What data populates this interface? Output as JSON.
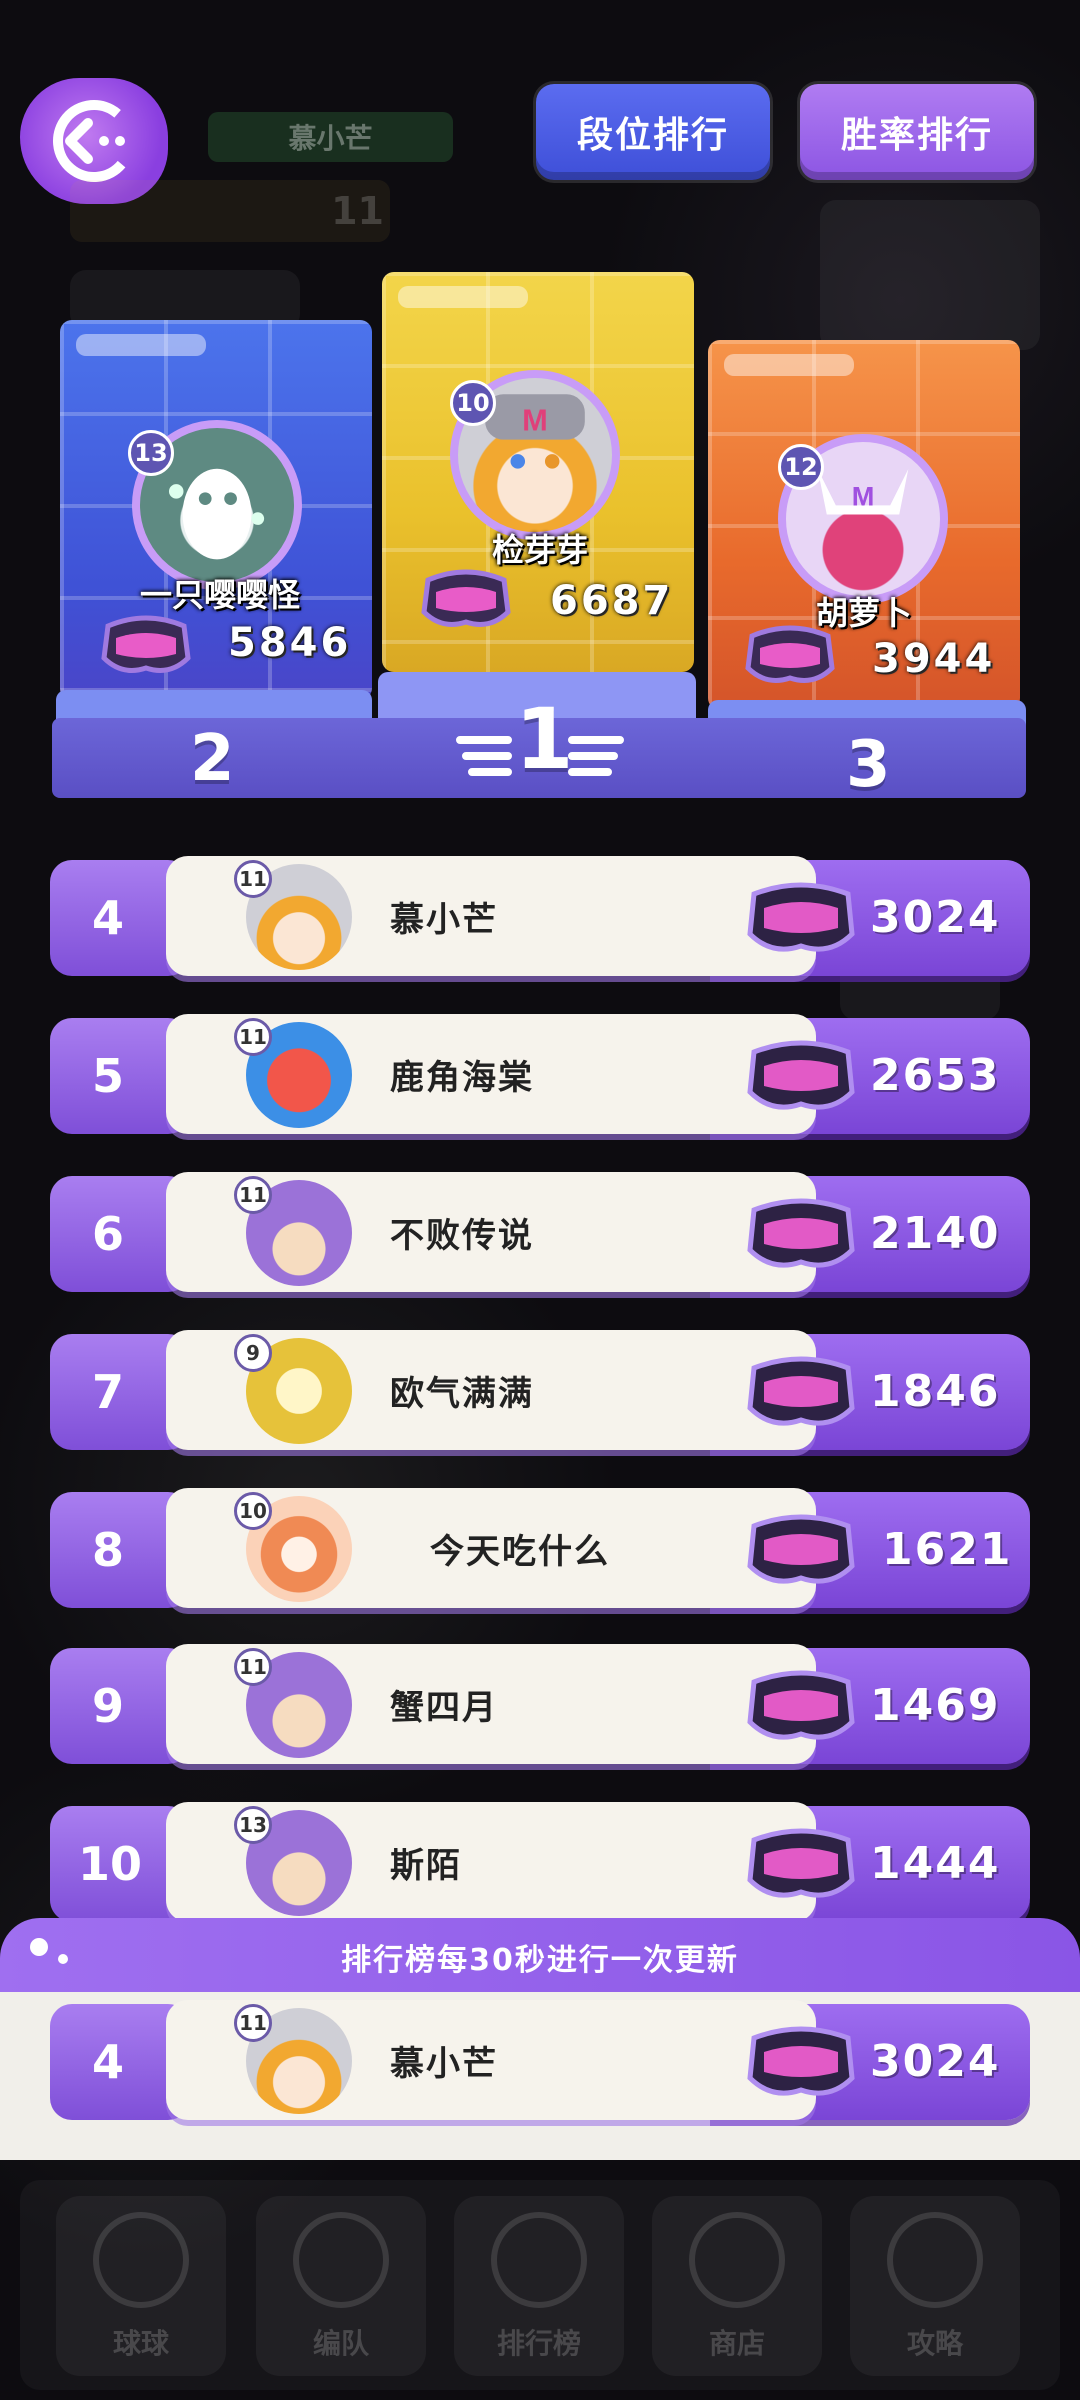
{
  "header": {
    "player_name": "慕小芒",
    "player_level": "11",
    "tabs": [
      {
        "label": "段位排行",
        "active": true
      },
      {
        "label": "胜率排行",
        "active": false
      }
    ]
  },
  "podium": [
    {
      "rank": "2",
      "name": "一只嘤嘤怪",
      "level": "13",
      "score": "5846",
      "color": "#4c74ec"
    },
    {
      "rank": "1",
      "name": "检芽芽",
      "level": "10",
      "score": "6687",
      "color": "#f3d54a"
    },
    {
      "rank": "3",
      "name": "胡萝卜",
      "level": "12",
      "score": "3944",
      "color": "#f6944a"
    }
  ],
  "leaderboard": [
    {
      "rank": "4",
      "name": "慕小芒",
      "level": "11",
      "score": "3024",
      "avatar": "gray-hat-orange-hood-avatar"
    },
    {
      "rank": "5",
      "name": "鹿角海棠",
      "level": "11",
      "score": "2653",
      "avatar": "red-hair-blue-avatar"
    },
    {
      "rank": "6",
      "name": "不败传说",
      "level": "11",
      "score": "2140",
      "avatar": "purple-hat-girl-avatar"
    },
    {
      "rank": "7",
      "name": "欧气满满",
      "level": "9",
      "score": "1846",
      "avatar": "gold-emblem-avatar"
    },
    {
      "rank": "8",
      "name": "今天吃什么",
      "level": "10",
      "score": "1621",
      "avatar": "orange-flame-avatar"
    },
    {
      "rank": "9",
      "name": "蟹四月",
      "level": "11",
      "score": "1469",
      "avatar": "purple-hat-girl-avatar"
    },
    {
      "rank": "10",
      "name": "斯陌",
      "level": "13",
      "score": "1444",
      "avatar": "purple-hat-girl-avatar"
    }
  ],
  "update_notice": "排行榜每30秒进行一次更新",
  "self_entry": {
    "rank": "4",
    "name": "慕小芒",
    "level": "11",
    "score": "3024"
  },
  "nav": [
    {
      "label": "球球",
      "icon": "ball-icon"
    },
    {
      "label": "编队",
      "icon": "team-icon"
    },
    {
      "label": "排行榜",
      "icon": "leaderboard-icon"
    },
    {
      "label": "商店",
      "icon": "cart-icon"
    },
    {
      "label": "攻略",
      "icon": "guide-icon"
    }
  ],
  "colors": {
    "accent_purple": "#8c55e3",
    "tab_active": "#3e4fd8",
    "card_bg": "#f6f3ec",
    "background": "#0d0c10"
  }
}
